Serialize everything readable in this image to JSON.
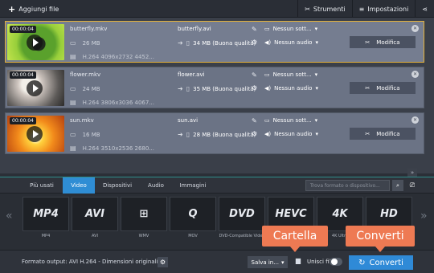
{
  "toolbar": {
    "add_files": "Aggiungi file",
    "tools": "Strumenti",
    "settings": "Impostazioni"
  },
  "files": [
    {
      "duration": "00:00:04",
      "name": "butterfly.mkv",
      "size": "26 MB",
      "info": "H.264 4096x2732 4452...",
      "output_name": "butterfly.avi",
      "output_size": "34 MB (Buona qualità)",
      "subtitles": "Nessun sott...",
      "audio": "Nessun audio",
      "edit": "Modifica"
    },
    {
      "duration": "00:00:04",
      "name": "flower.mkv",
      "size": "24 MB",
      "info": "H.264 3806x3036 4067...",
      "output_name": "flower.avi",
      "output_size": "35 MB (Buona qualità)",
      "subtitles": "Nessun sott...",
      "audio": "Nessun audio",
      "edit": "Modifica"
    },
    {
      "duration": "00:00:04",
      "name": "sun.mkv",
      "size": "16 MB",
      "info": "H.264 3510x2536 2680...",
      "output_name": "sun.avi",
      "output_size": "28 MB (Buona qualità)",
      "subtitles": "Nessun sott...",
      "audio": "Nessun audio",
      "edit": "Modifica"
    }
  ],
  "tabs": [
    "Più usati",
    "Video",
    "Dispositivi",
    "Audio",
    "Immagini"
  ],
  "search_placeholder": "Trova formato o dispositivo...",
  "formats": [
    {
      "logo": "MP4",
      "label": "MP4"
    },
    {
      "logo": "AVI",
      "label": "AVI"
    },
    {
      "logo": "⊞",
      "label": "WMV"
    },
    {
      "logo": "Q",
      "label": "MOV"
    },
    {
      "logo": "DVD",
      "label": "DVD-Compatible Video"
    },
    {
      "logo": "HEVC",
      "label": ""
    },
    {
      "logo": "4K",
      "label": "4K Ultra"
    },
    {
      "logo": "HD",
      "label": ""
    }
  ],
  "bottom": {
    "output_format": "Formato output: AVI H.264 - Dimensioni originali",
    "save_to": "Salva in...",
    "merge": "Unisci file",
    "convert": "Converti"
  },
  "callouts": {
    "folder": "Cartella",
    "convert": "Converti"
  }
}
